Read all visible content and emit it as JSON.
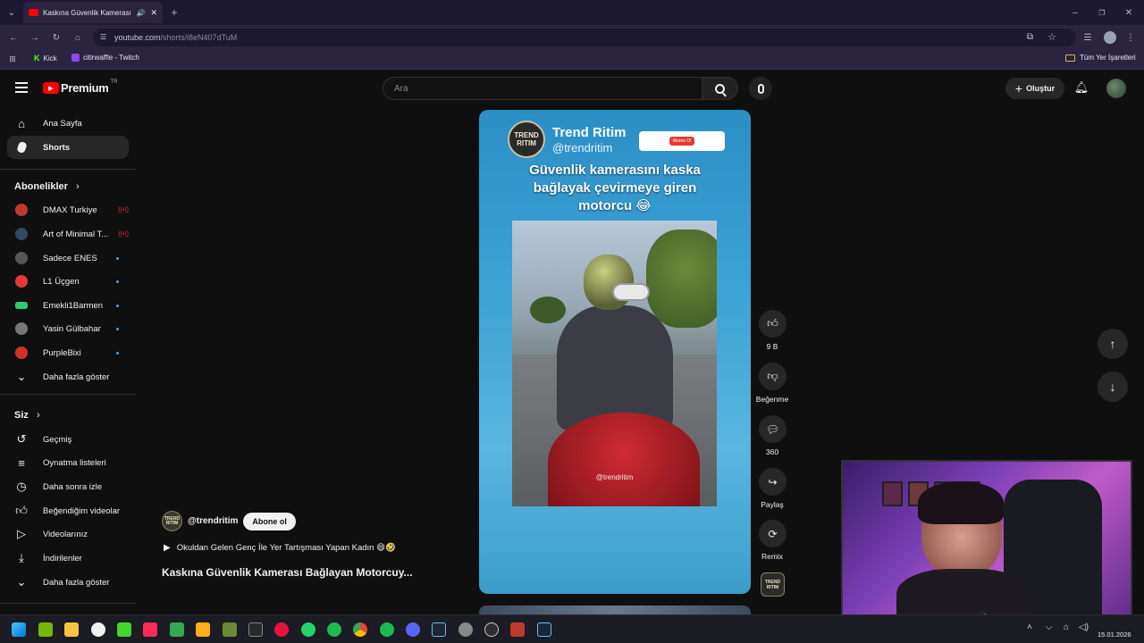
{
  "browser": {
    "tab_title": "Kaskına Güvenlik Kamerası",
    "url_host": "youtube.com",
    "url_path": "/shorts/i8eN407dTuM",
    "bookmarks": [
      "Kick",
      "citirwaffle - Twitch"
    ],
    "all_bookmarks": "Tüm Yer İşaretleri"
  },
  "youtube": {
    "logo_text": "Premium",
    "region": "TR",
    "search_placeholder": "Ara",
    "create_label": "Oluştur",
    "sidebar": {
      "main": [
        {
          "label": "Ana Sayfa",
          "icon": "home-icon"
        },
        {
          "label": "Shorts",
          "icon": "shorts-icon",
          "active": true
        }
      ],
      "subscriptions_header": "Abonelikler",
      "subscriptions": [
        {
          "label": "DMAX Turkiye",
          "status": "live",
          "color": "#c0392b"
        },
        {
          "label": "Art of Minimal T...",
          "status": "live",
          "color": "#34495e"
        },
        {
          "label": "Sadece ENES",
          "status": "new",
          "color": "#555555"
        },
        {
          "label": "L1 Üçgen",
          "status": "new",
          "color": "#e53935"
        },
        {
          "label": "Emekli1Barmen",
          "status": "new",
          "color": "#2ecc71"
        },
        {
          "label": "Yasin Gülbahar",
          "status": "new",
          "color": "#777777"
        },
        {
          "label": "PurpleBixi",
          "status": "new",
          "color": "#d32f2f"
        }
      ],
      "show_more": "Daha fazla göster",
      "you_header": "Siz",
      "you_items": [
        {
          "label": "Geçmiş",
          "icon": "history-icon"
        },
        {
          "label": "Oynatma listeleri",
          "icon": "playlist-icon"
        },
        {
          "label": "Daha sonra izle",
          "icon": "watch-later-icon"
        },
        {
          "label": "Beğendiğim videolar",
          "icon": "like-icon"
        },
        {
          "label": "Videolarınız",
          "icon": "your-videos-icon"
        },
        {
          "label": "İndirilenler",
          "icon": "download-icon"
        }
      ],
      "you_show_more": "Daha fazla göster"
    },
    "short": {
      "channel_name": "Trend Ritim",
      "channel_handle": "@trendritim",
      "overlay_subscribe": "Abone Ol",
      "caption_lines": [
        "Güvenlik kamerasını kaska",
        "bağlayak çevirmeye giren",
        "motorcu 😂"
      ],
      "watermark": "@trendritim",
      "channel_logo_text": "TREND RITIM",
      "info_handle": "@trendritim",
      "subscribe_button": "Abone ol",
      "playlist_title": "Okuldan Gelen Genç İle Yer Tartışması Yapan Kadın 😄🤣",
      "video_title": "Kaskına Güvenlik Kamerası Bağlayan Motorcuy..."
    },
    "actions": {
      "likes": "9 B",
      "dislike_label": "Beğenme",
      "comments": "360",
      "share_label": "Paylaş",
      "remix_label": "Remix"
    }
  },
  "taskbar": {
    "date": "15.01.2026"
  }
}
